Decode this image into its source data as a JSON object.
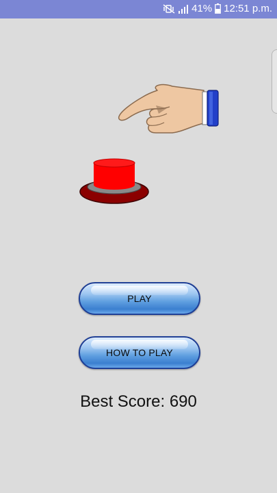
{
  "status_bar": {
    "battery_percent": "41%",
    "time": "12:51 p.m.",
    "icons": [
      "mute-vibrate-icon",
      "signal-icon",
      "battery-icon"
    ],
    "background_color": "#7b86d4"
  },
  "illustration": {
    "hand_icon": "pointing-hand-icon",
    "button_icon": "red-push-button-icon",
    "button_color": "#ff0000",
    "base_color": "#8b0000"
  },
  "menu": {
    "play_label": "PLAY",
    "how_to_play_label": "HOW TO PLAY"
  },
  "score": {
    "best_score_text": "Best Score: 690"
  }
}
